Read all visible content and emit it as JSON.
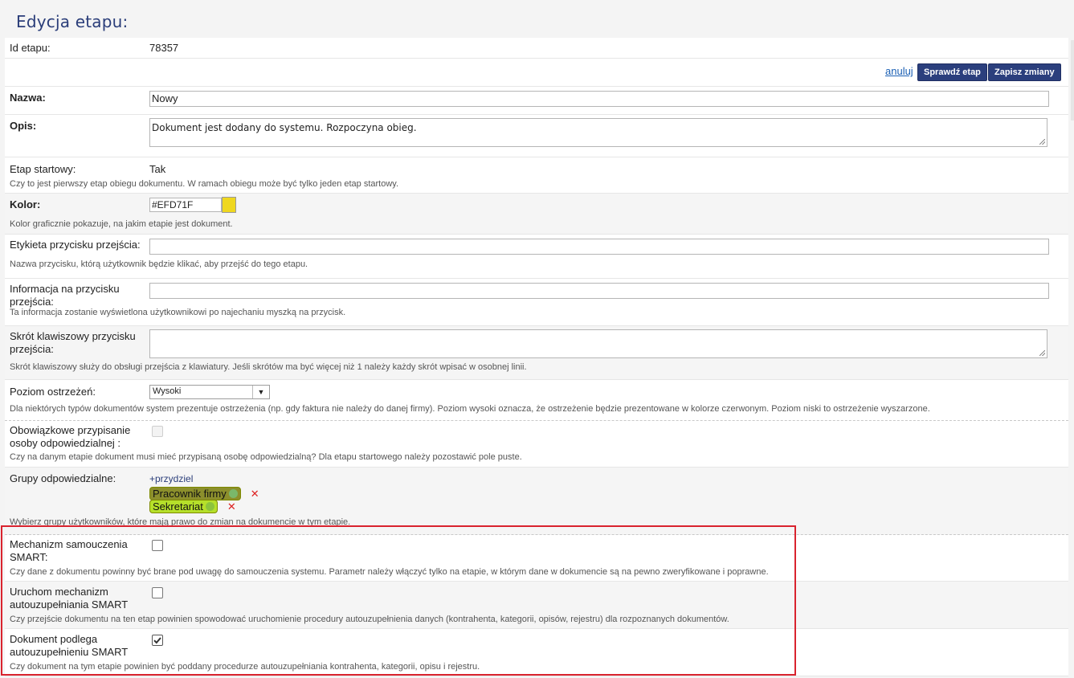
{
  "page_title": "Edycja etapu:",
  "stage_id": {
    "label": "Id etapu:",
    "value": "78357"
  },
  "actions": {
    "cancel": "anuluj",
    "check": "Sprawdź etap",
    "save": "Zapisz zmiany"
  },
  "name": {
    "label": "Nazwa:",
    "value": "Nowy"
  },
  "description": {
    "label": "Opis:",
    "value": "Dokument jest dodany do systemu. Rozpoczyna obieg."
  },
  "start_stage": {
    "label": "Etap startowy:",
    "value": "Tak",
    "hint": "Czy to jest pierwszy etap obiegu dokumentu. W ramach obiegu może być tylko jeden etap startowy."
  },
  "color": {
    "label": "Kolor:",
    "value": "#EFD71F",
    "swatch": "#EFD71F",
    "hint": "Kolor graficznie pokazuje, na jakim etapie jest dokument."
  },
  "button_label": {
    "label": "Etykieta przycisku przejścia:",
    "value": "",
    "hint": "Nazwa przycisku, którą użytkownik będzie klikać, aby przejść do tego etapu."
  },
  "button_info": {
    "label": "Informacja na przycisku przejścia:",
    "value": "",
    "hint": "Ta informacja zostanie wyświetlona użytkownikowi po najechaniu myszką na przycisk."
  },
  "shortcut": {
    "label": "Skrót klawiszowy przycisku przejścia:",
    "value": "",
    "hint": "Skrót klawiszowy służy do obsługi przejścia z klawiatury. Jeśli skrótów ma być więcej niż 1 należy każdy skrót wpisać w osobnej linii."
  },
  "warning_level": {
    "label": "Poziom ostrzeżeń:",
    "selected": "Wysoki",
    "hint": "Dla niektórych typów dokumentów system prezentuje ostrzeżenia (np. gdy faktura nie należy do danej firmy). Poziom wysoki oznacza, że ostrzeżenie będzie prezentowane w kolorze czerwonym. Poziom niski to ostrzeżenie wyszarzone."
  },
  "mandatory_person": {
    "label": "Obowiązkowe przypisanie osoby odpowiedzialnej :",
    "checked": false,
    "hint": "Czy na danym etapie dokument musi mieć przypisaną osobę odpowiedzialną? Dla etapu startowego należy pozostawić pole puste."
  },
  "groups": {
    "label": "Grupy odpowiedzialne:",
    "assign": "+przydziel",
    "items": [
      {
        "name": "Pracownik firmy",
        "bg": "#8c8f2c",
        "dot": "#7ab86a"
      },
      {
        "name": "Sekretariat",
        "bg": "#b6e02a",
        "dot": "#8cc43c"
      }
    ],
    "hint": "Wybierz grupy użytkowników, które mają prawo do zmian na dokumencie w tym etapie."
  },
  "smart_learning": {
    "label": "Mechanizm samouczenia SMART:",
    "checked": false,
    "hint": "Czy dane z dokumentu powinny być brane pod uwagę do samouczenia systemu. Parametr należy włączyć tylko na etapie, w którym dane w dokumencie są na pewno zweryfikowane i poprawne."
  },
  "smart_autofill_run": {
    "label": "Uruchom mechanizm autouzupełniania SMART",
    "checked": false,
    "hint": "Czy przejście dokumentu na ten etap powinien spowodować uruchomienie procedury autouzupełnienia danych (kontrahenta, kategorii, opisów, rejestru) dla rozpoznanych dokumentów."
  },
  "smart_autofill_subject": {
    "label": "Dokument podlega autouzupełnieniu SMART",
    "checked": true,
    "hint": "Czy dokument na tym etapie powinien być poddany procedurze autouzupełniania kontrahenta, kategorii, opisu i rejestru."
  },
  "colors": {
    "accent": "#2B3F7D",
    "title": "#2A3D79",
    "highlight": "#D9232E"
  }
}
